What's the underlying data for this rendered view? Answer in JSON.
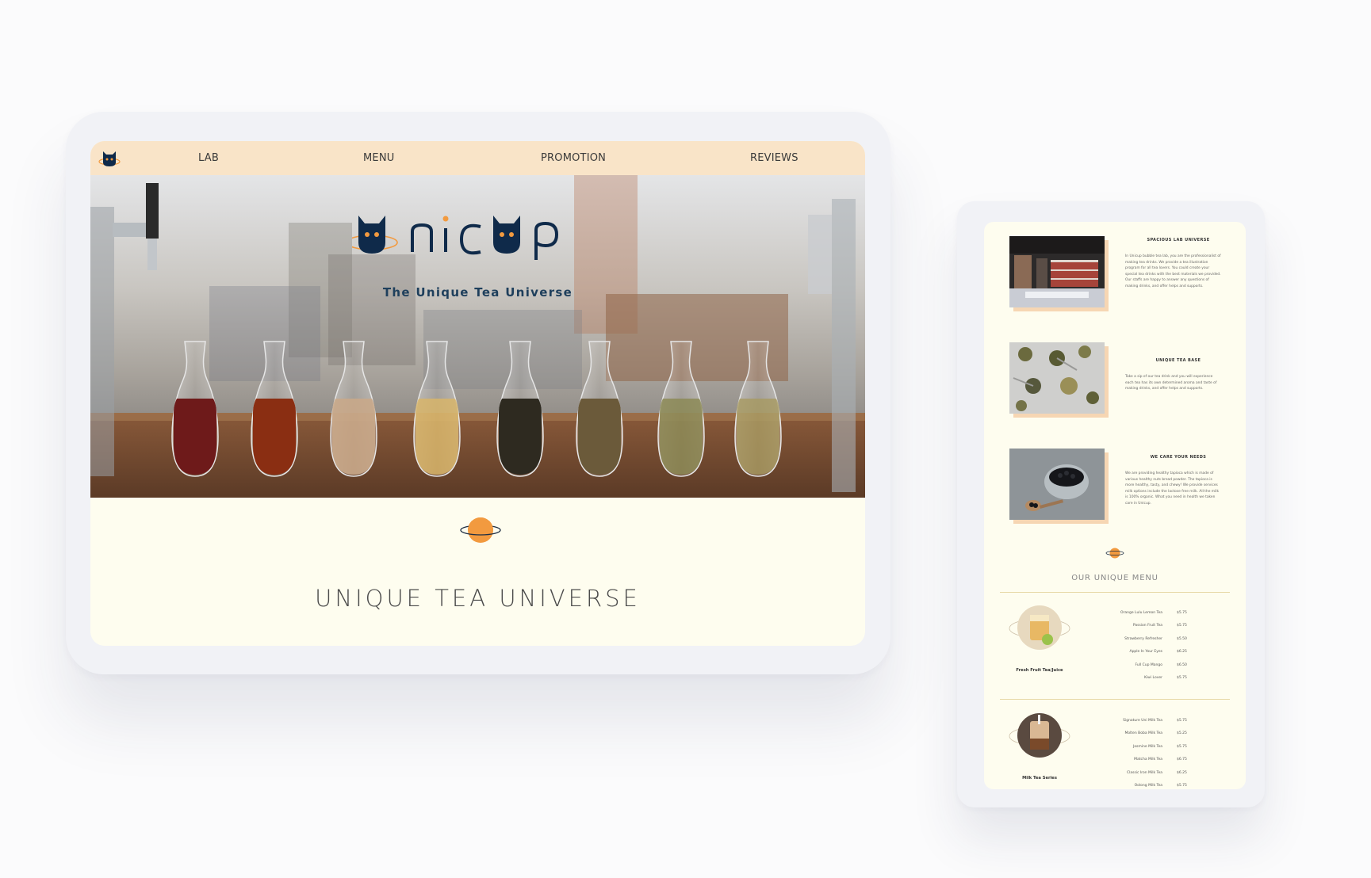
{
  "nav": {
    "items": [
      "LAB",
      "MENU",
      "PROMOTION",
      "REVIEWS"
    ]
  },
  "hero": {
    "brand": "unicup",
    "tagline": "The Unique Tea Universe"
  },
  "section": {
    "heading": "UNIQUE TEA UNIVERSE"
  },
  "mobile": {
    "features": [
      {
        "title": "SPACIOUS LAB UNIVERSE",
        "text": "In Unicup bubble tea lab, you are the professionalist of making tea drinks. We provide a tea illustration program for all tea lovers. You could create your special tea drinks with the best materials we provided. Our staffs are happy to answer any questions of making drinks, and offer helps and supports."
      },
      {
        "title": "UNIQUE TEA BASE",
        "text": "Take a sip of our tea drink and you will experience each tea has its own determined aroma and taste of making drinks, and offer helps and supports."
      },
      {
        "title": "WE CARE YOUR NEEDS",
        "text": "We are providing healthy tapioca which is made of various healthy nuts bread powder. The tapioca is more healthy, tasty, and chewy! We provide services milk options include the lactose free milk. All the milk is 100% organic. What you need in health we taken care in Unicup."
      }
    ],
    "menu_heading": "OUR UNIQUE MENU",
    "menu_sections": [
      {
        "label": "Fresh Fruit Tea/Juice",
        "items": [
          {
            "name": "Orange Lulu Lemon Tea",
            "price": "$5.75"
          },
          {
            "name": "Passion Fruit Tea",
            "price": "$5.75"
          },
          {
            "name": "Strawberry Refresher",
            "price": "$5.50"
          },
          {
            "name": "Apple In Your Eyes",
            "price": "$6.25"
          },
          {
            "name": "Full Cup Mango",
            "price": "$6.50"
          },
          {
            "name": "Kiwi Lover",
            "price": "$5.75"
          }
        ]
      },
      {
        "label": "Milk Tea Series",
        "items": [
          {
            "name": "Signature Uni Milk Tea",
            "price": "$5.75"
          },
          {
            "name": "Molten Boba Milk Tea",
            "price": "$5.25"
          },
          {
            "name": "Jasmine Milk Tea",
            "price": "$5.75"
          },
          {
            "name": "Matcha Milk Tea",
            "price": "$6.75"
          },
          {
            "name": "Classic Iron Milk Tea",
            "price": "$6.25"
          },
          {
            "name": "Oolong Milk Tea",
            "price": "$5.75"
          }
        ]
      }
    ]
  },
  "colors": {
    "nav_bg": "#f9e4c8",
    "page_bg": "#fefdef",
    "brand_navy": "#0f2a4a",
    "accent_orange": "#f29a3f",
    "tagline": "#1e3f5c"
  }
}
